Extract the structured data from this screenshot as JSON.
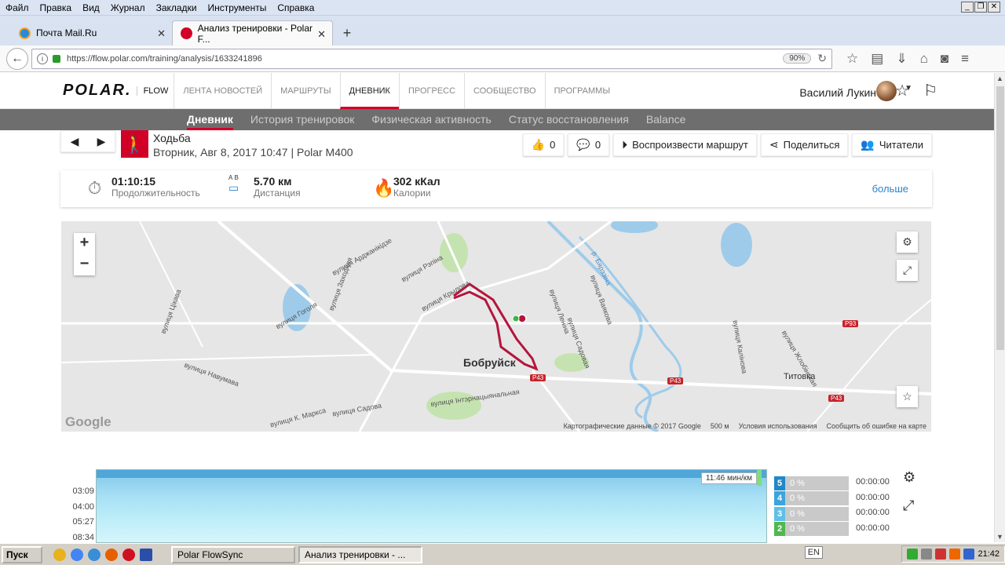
{
  "browser": {
    "menu": [
      "Файл",
      "Правка",
      "Вид",
      "Журнал",
      "Закладки",
      "Инструменты",
      "Справка"
    ],
    "tabs": [
      {
        "label": "Почта Mail.Ru",
        "active": false
      },
      {
        "label": "Анализ тренировки - Polar F...",
        "active": true
      }
    ],
    "url": "https://flow.polar.com/training/analysis/1633241896",
    "zoom": "90%"
  },
  "polar": {
    "logo": "POLAR.",
    "flow": "FLOW",
    "nav": [
      "ЛЕНТА НОВОСТЕЙ",
      "МАРШРУТЫ",
      "ДНЕВНИК",
      "ПРОГРЕСС",
      "СООБЩЕСТВО",
      "ПРОГРАММЫ"
    ],
    "user_name": "Василий Лукин",
    "subnav": [
      "Дневник",
      "История тренировок",
      "Физическая активность",
      "Статус восстановления",
      "Balance"
    ]
  },
  "exercise": {
    "sport": "Ходьба",
    "date": "Вторник, Авг 8, 2017 10:47 | Polar M400",
    "likes": "0",
    "comments": "0",
    "replay": "Воспроизвести маршрут",
    "share": "Поделиться",
    "readers": "Читатели"
  },
  "summary": {
    "duration_value": "01:10:15",
    "duration_label": "Продолжительность",
    "distance_value": "5.70 км",
    "distance_label": "Дистанция",
    "distance_ab": "А В",
    "calories_value": "302 кКал",
    "calories_label": "Калории",
    "more": "больше"
  },
  "map": {
    "city": "Бобруйск",
    "village": "Титовка",
    "streets": [
      "вулиця Арджанікідзе",
      "вулиця Рэпіна",
      "вулиця Заходняя",
      "вулиця Гоголя",
      "вулиця Цікава",
      "вулиця Навумава",
      "вулиця Крылова",
      "вулиця Леніна",
      "вулиця Садовая",
      "вулиця Ваякова",
      "вулиця Інтэрнацыянальная",
      "вулиця Садова",
      "вулиця К. Маркса",
      "вулиця Жлобінская",
      "вулиця Калінова",
      "р. Бярэзіна"
    ],
    "roads": [
      "P43",
      "P93"
    ],
    "copyright": "Картографические данные © 2017 Google",
    "scale": "500 м",
    "terms": "Условия использования",
    "report": "Сообщить об ошибке на карте",
    "google": "Google"
  },
  "graph": {
    "y_ticks": [
      "03:09",
      "04:00",
      "05:27",
      "08:34"
    ],
    "tooltip": "11:46 мин/км",
    "zones": [
      {
        "n": "5",
        "pct": "0 %",
        "time": "00:00:00",
        "color": "#1e88c8"
      },
      {
        "n": "4",
        "pct": "0 %",
        "time": "00:00:00",
        "color": "#3ba5dd"
      },
      {
        "n": "3",
        "pct": "0 %",
        "time": "00:00:00",
        "color": "#5fbfe6"
      },
      {
        "n": "2",
        "pct": "0 %",
        "time": "00:00:00",
        "color": "#4fb84f"
      }
    ]
  },
  "taskbar": {
    "start": "Пуск",
    "tasks": [
      "Polar FlowSync",
      "Анализ тренировки - ..."
    ],
    "lang": "EN",
    "time": "21:42"
  }
}
